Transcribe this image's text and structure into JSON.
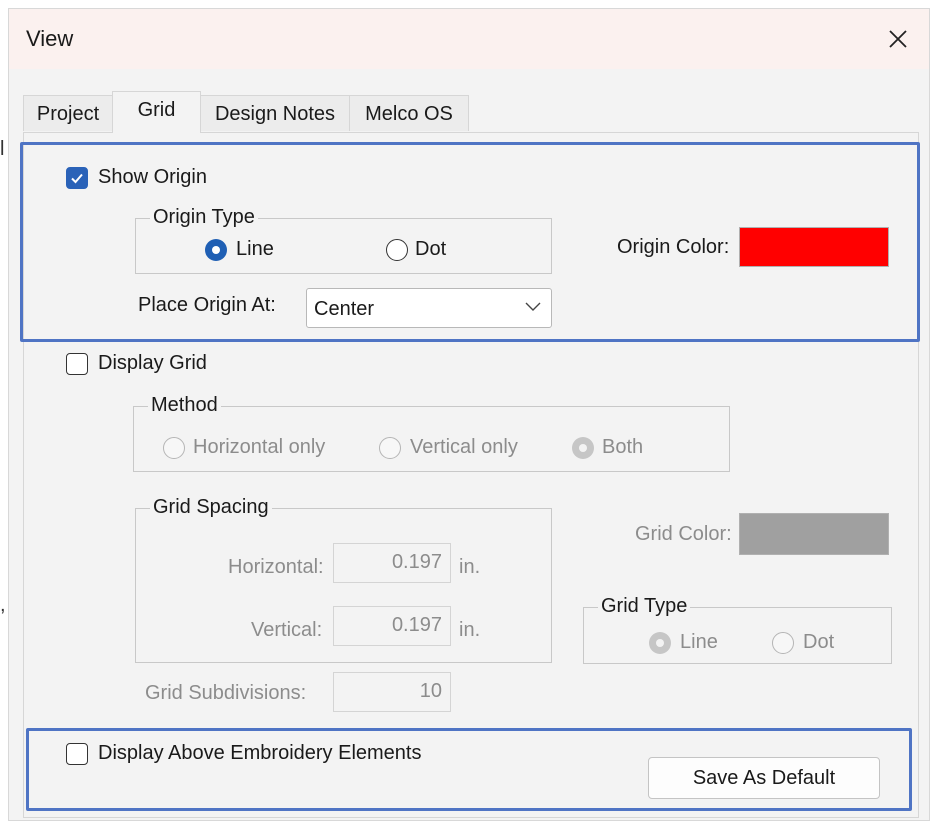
{
  "window": {
    "title": "View"
  },
  "tabs": [
    "Project",
    "Grid",
    "Design Notes",
    "Melco OS"
  ],
  "origin": {
    "show_origin_label": "Show Origin",
    "show_origin_checked": true,
    "origin_type_legend": "Origin Type",
    "line_label": "Line",
    "dot_label": "Dot",
    "selected_type": "Line",
    "origin_color_label": "Origin Color:",
    "origin_color": "#ff0000",
    "place_origin_label": "Place Origin At:",
    "place_origin_value": "Center"
  },
  "grid": {
    "display_grid_label": "Display Grid",
    "display_grid_checked": false,
    "method_legend": "Method",
    "method_options": [
      "Horizontal only",
      "Vertical only",
      "Both"
    ],
    "method_selected": "Both",
    "spacing_legend": "Grid Spacing",
    "horizontal_label": "Horizontal:",
    "horizontal_value": "0.197",
    "vertical_label": "Vertical:",
    "vertical_value": "0.197",
    "unit": "in.",
    "subdivisions_label": "Grid Subdivisions:",
    "subdivisions_value": "10",
    "grid_color_label": "Grid Color:",
    "grid_color": "#a0a0a0",
    "grid_type_legend": "Grid Type",
    "grid_type_line": "Line",
    "grid_type_dot": "Dot",
    "grid_type_selected": "Line"
  },
  "footer": {
    "display_above_label": "Display Above Embroidery Elements",
    "display_above_checked": false,
    "save_default_label": "Save As Default"
  },
  "colors": {
    "highlight": "#4f74c4",
    "accent": "#1f5fb4"
  }
}
